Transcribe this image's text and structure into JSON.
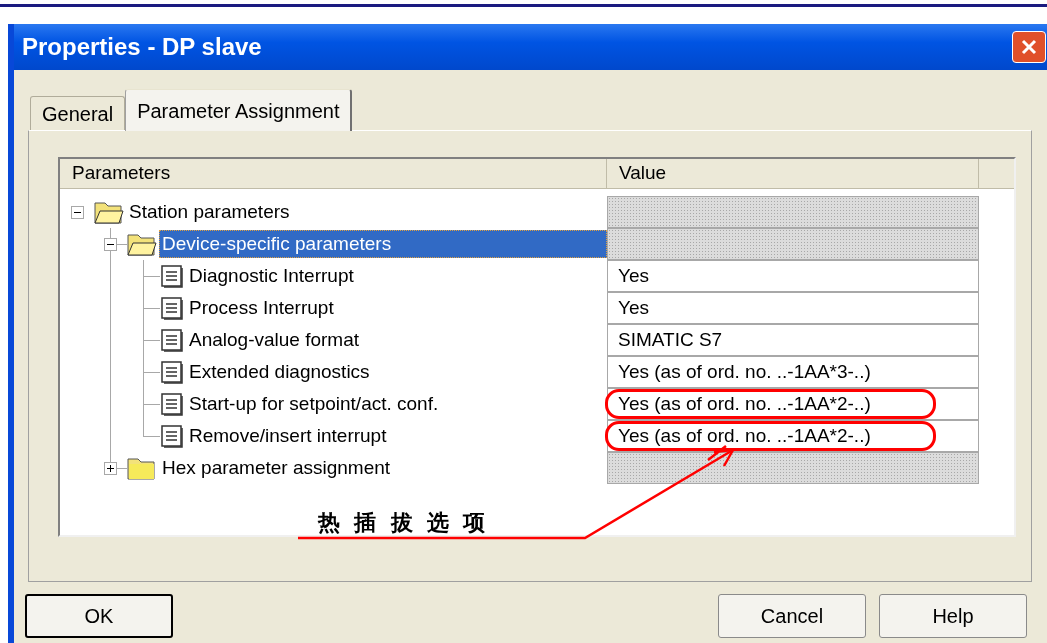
{
  "window": {
    "title": "Properties - DP slave"
  },
  "tabs": [
    {
      "label": "General",
      "selected": false
    },
    {
      "label": "Parameter Assignment",
      "selected": true
    }
  ],
  "table": {
    "columns": [
      "Parameters",
      "Value"
    ],
    "rows": [
      {
        "kind": "folder",
        "label": "Station parameters",
        "expanded": true,
        "selected": false,
        "children": [
          {
            "kind": "folder",
            "label": "Device-specific parameters",
            "expanded": true,
            "selected": true,
            "children": [
              {
                "kind": "parameter",
                "label": "Diagnostic Interrupt",
                "value": "Yes",
                "selected": false,
                "circled": false
              },
              {
                "kind": "parameter",
                "label": "Process Interrupt",
                "value": "Yes",
                "selected": false,
                "circled": false
              },
              {
                "kind": "parameter",
                "label": "Analog-value format",
                "value": "SIMATIC S7",
                "selected": false,
                "circled": false
              },
              {
                "kind": "parameter",
                "label": "Extended diagnostics",
                "value": "Yes (as of ord. no. ..-1AA*3-..)",
                "selected": false,
                "circled": false
              },
              {
                "kind": "parameter",
                "label": "Start-up for setpoint/act. conf.",
                "value": "Yes (as of ord. no. ..-1AA*2-..)",
                "selected": false,
                "circled": true
              },
              {
                "kind": "parameter",
                "label": "Remove/insert interrupt",
                "value": "Yes (as of ord. no. ..-1AA*2-..)",
                "selected": false,
                "circled": true
              }
            ]
          },
          {
            "kind": "folder",
            "label": "Hex parameter assignment",
            "expanded": false,
            "selected": false
          }
        ]
      }
    ]
  },
  "annotation": {
    "text": "热插拔选项"
  },
  "buttons": [
    {
      "label": "OK",
      "default": true
    },
    {
      "label": "Cancel",
      "default": false
    },
    {
      "label": "Help",
      "default": false
    }
  ]
}
